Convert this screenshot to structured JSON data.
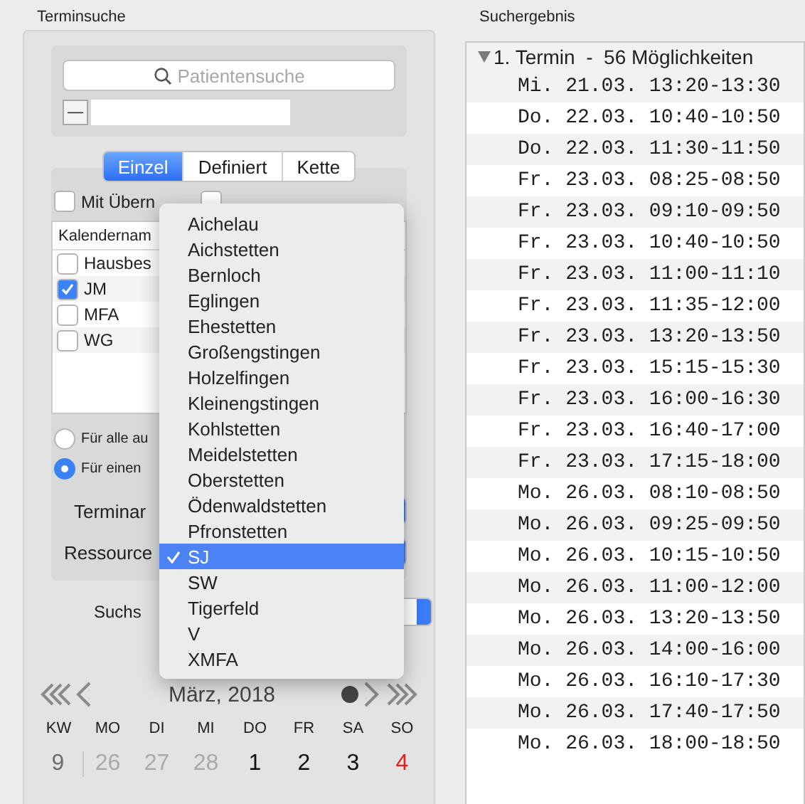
{
  "search_panel": {
    "title": "Terminsuche",
    "search_field": {
      "placeholder": "Patientensuche"
    },
    "minus_button": "—",
    "tabs": [
      {
        "label": "Einzel",
        "selected": true
      },
      {
        "label": "Definiert",
        "selected": false
      },
      {
        "label": "Kette",
        "selected": false
      }
    ],
    "overnight": {
      "label": "Mit Übern",
      "checked": false
    },
    "op_entry": {
      "checked": false
    },
    "calendar_table": {
      "column": "Kalendernam",
      "rows": [
        {
          "label": "Hausbes",
          "checked": false
        },
        {
          "label": "JM",
          "checked": true
        },
        {
          "label": "MFA",
          "checked": false
        },
        {
          "label": "WG",
          "checked": false
        }
      ]
    },
    "radios": [
      {
        "label": "Für alle au",
        "selected": false
      },
      {
        "label": "Für einen",
        "selected": true
      }
    ],
    "popups": [
      {
        "label": "Terminar"
      },
      {
        "label": "Ressource"
      }
    ],
    "search_mode": {
      "label": "Suchs"
    },
    "month": "März, 2018",
    "weekdays": [
      "KW",
      "MO",
      "DI",
      "MI",
      "DO",
      "FR",
      "SA",
      "SO"
    ],
    "week": {
      "number": "9",
      "days": [
        {
          "text": "26",
          "kind": "other"
        },
        {
          "text": "27",
          "kind": "other"
        },
        {
          "text": "28",
          "kind": "other"
        },
        {
          "text": "1",
          "kind": "day"
        },
        {
          "text": "2",
          "kind": "day"
        },
        {
          "text": "3",
          "kind": "day"
        },
        {
          "text": "4",
          "kind": "sunday"
        }
      ]
    },
    "menu": [
      {
        "label": "Aichelau",
        "selected": false
      },
      {
        "label": "Aichstetten",
        "selected": false
      },
      {
        "label": "Bernloch",
        "selected": false
      },
      {
        "label": "Eglingen",
        "selected": false
      },
      {
        "label": "Ehestetten",
        "selected": false
      },
      {
        "label": "Großengstingen",
        "selected": false
      },
      {
        "label": "Holzelfingen",
        "selected": false
      },
      {
        "label": "Kleinengstingen",
        "selected": false
      },
      {
        "label": "Kohlstetten",
        "selected": false
      },
      {
        "label": "Meidelstetten",
        "selected": false
      },
      {
        "label": "Oberstetten",
        "selected": false
      },
      {
        "label": "Ödenwaldstetten",
        "selected": false
      },
      {
        "label": "Pfronstetten",
        "selected": false
      },
      {
        "label": "SJ",
        "selected": true
      },
      {
        "label": "SW",
        "selected": false
      },
      {
        "label": "Tigerfeld",
        "selected": false
      },
      {
        "label": "V",
        "selected": false
      },
      {
        "label": "XMFA",
        "selected": false
      }
    ]
  },
  "results": {
    "title": "Suchergebnis",
    "group": {
      "title": "1. Termin  -  56 Möglichkeiten",
      "expanded": true,
      "rows": [
        "Mi. 21.03. 13:20-13:30",
        "Do. 22.03. 10:40-10:50",
        "Do. 22.03. 11:30-11:50",
        "Fr. 23.03. 08:25-08:50",
        "Fr. 23.03. 09:10-09:50",
        "Fr. 23.03. 10:40-10:50",
        "Fr. 23.03. 11:00-11:10",
        "Fr. 23.03. 11:35-12:00",
        "Fr. 23.03. 13:20-13:50",
        "Fr. 23.03. 15:15-15:30",
        "Fr. 23.03. 16:00-16:30",
        "Fr. 23.03. 16:40-17:00",
        "Fr. 23.03. 17:15-18:00",
        "Mo. 26.03. 08:10-08:50",
        "Mo. 26.03. 09:25-09:50",
        "Mo. 26.03. 10:15-10:50",
        "Mo. 26.03. 11:00-12:00",
        "Mo. 26.03. 13:20-13:50",
        "Mo. 26.03. 14:00-16:00",
        "Mo. 26.03. 16:10-17:30",
        "Mo. 26.03. 17:40-17:50",
        "Mo. 26.03. 18:00-18:50"
      ]
    }
  }
}
